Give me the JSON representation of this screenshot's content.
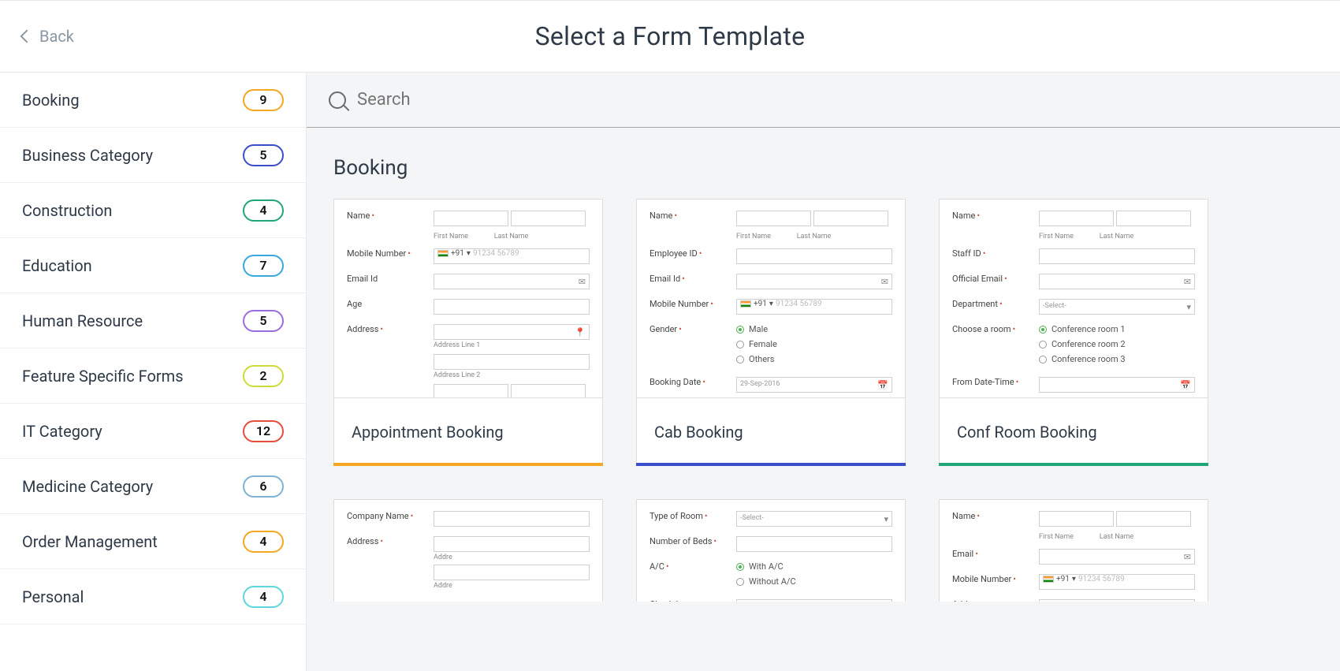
{
  "header": {
    "back": "Back",
    "title": "Select a Form Template"
  },
  "search": {
    "placeholder": "Search"
  },
  "sidebar": {
    "items": [
      {
        "label": "Booking",
        "count": "9",
        "color": "#f5a623"
      },
      {
        "label": "Business Category",
        "count": "5",
        "color": "#3a4fc9"
      },
      {
        "label": "Construction",
        "count": "4",
        "color": "#21a67a"
      },
      {
        "label": "Education",
        "count": "7",
        "color": "#3aa7de"
      },
      {
        "label": "Human Resource",
        "count": "5",
        "color": "#9b6de0"
      },
      {
        "label": "Feature Specific Forms",
        "count": "2",
        "color": "#cddc39"
      },
      {
        "label": "IT Category",
        "count": "12",
        "color": "#e74c3c"
      },
      {
        "label": "Medicine Category",
        "count": "6",
        "color": "#7fb3d5"
      },
      {
        "label": "Order Management",
        "count": "4",
        "color": "#f5a623"
      },
      {
        "label": "Personal",
        "count": "4",
        "color": "#5dd6dd"
      }
    ]
  },
  "section": {
    "title": "Booking"
  },
  "cards": [
    {
      "title": "Appointment Booking",
      "accent": "#f5a623",
      "fields": {
        "name": "Name",
        "first": "First Name",
        "last": "Last Name",
        "mobile": "Mobile Number",
        "code": "+91",
        "ph": "91234 56789",
        "email": "Email Id",
        "age": "Age",
        "addr": "Address",
        "a1": "Address Line 1",
        "a2": "Address Line 2"
      }
    },
    {
      "title": "Cab Booking",
      "accent": "#3a4fc9",
      "fields": {
        "name": "Name",
        "first": "First Name",
        "last": "Last Name",
        "emp": "Employee ID",
        "email": "Email Id",
        "mobile": "Mobile Number",
        "code": "+91",
        "ph": "91234 56789",
        "gender": "Gender",
        "g1": "Male",
        "g2": "Female",
        "g3": "Others",
        "bdate": "Booking Date",
        "date": "29-Sep-2016"
      }
    },
    {
      "title": "Conf Room Booking",
      "accent": "#21a67a",
      "fields": {
        "name": "Name",
        "first": "First Name",
        "last": "Last Name",
        "staff": "Staff ID",
        "email": "Official Email",
        "dept": "Department",
        "sel": "-Select-",
        "room": "Choose a room",
        "r1": "Conference room 1",
        "r2": "Conference room 2",
        "r3": "Conference room 3",
        "from": "From Date-Time"
      }
    }
  ],
  "cards2": [
    {
      "fields": {
        "company": "Company Name",
        "addr": "Address",
        "a1": "Addre",
        "a2": "Addre"
      }
    },
    {
      "fields": {
        "type": "Type of Room",
        "sel": "-Select-",
        "beds": "Number of Beds",
        "ac": "A/C",
        "ac1": "With A/C",
        "ac2": "Without A/C",
        "check": "Check-In"
      }
    },
    {
      "fields": {
        "name": "Name",
        "first": "First Name",
        "last": "Last Name",
        "email": "Email",
        "mobile": "Mobile Number",
        "code": "+91",
        "ph": "91234 56789",
        "addr": "Address"
      }
    }
  ]
}
